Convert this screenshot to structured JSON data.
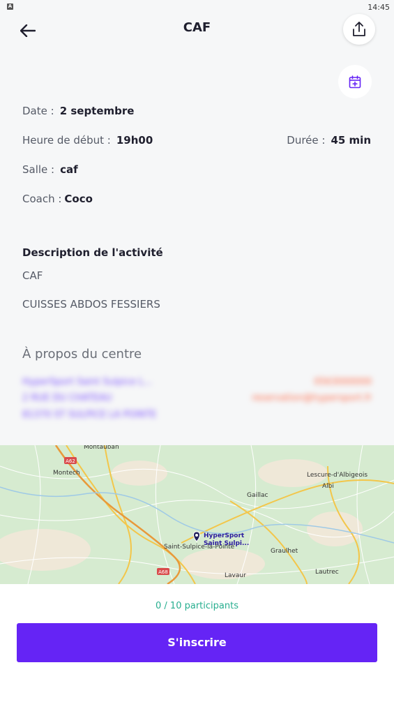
{
  "status_bar": {
    "time": "14:45",
    "notification_icon": "A"
  },
  "header": {
    "title": "CAF",
    "back_icon": "arrow-left-icon",
    "share_icon": "share-icon"
  },
  "calendar_action": {
    "icon": "calendar-plus-icon"
  },
  "details": {
    "date_label": "Date :",
    "date_value": "2 septembre",
    "start_label": "Heure de début :",
    "start_value": "19h00",
    "duration_label": "Durée :",
    "duration_value": "45 min",
    "room_label": "Salle :",
    "room_value": "caf",
    "coach_label": "Coach :",
    "coach_value": "Coco"
  },
  "description": {
    "title": "Description de l'activité",
    "lines": [
      "CAF",
      "CUISSES ABDOS FESSIERS"
    ]
  },
  "about": {
    "title": "À propos du centre",
    "left_lines": [
      "HyperSport Saint Sulpice L...",
      "2 RUE DU CHATEAU",
      "81370 ST SULPICE LA POINTE"
    ],
    "right_lines": [
      "0563000000",
      "reservation@hypersport.fr"
    ]
  },
  "map": {
    "labels": [
      "Montauban",
      "Montech",
      "A62",
      "Lescure-d'Albigeois",
      "Albi",
      "Gaillac",
      "Saint-Sulpice-la-Pointe",
      "Graulhet",
      "Lavaur",
      "A68",
      "Lautrec"
    ],
    "pin_label_1": "HyperSport",
    "pin_label_2": "Saint Sulpi..."
  },
  "footer": {
    "participants": "0 / 10 participants",
    "register_label": "S'inscrire"
  },
  "colors": {
    "accent": "#6524f5",
    "participants": "#27ae8f",
    "background": "#f6f7f8"
  }
}
